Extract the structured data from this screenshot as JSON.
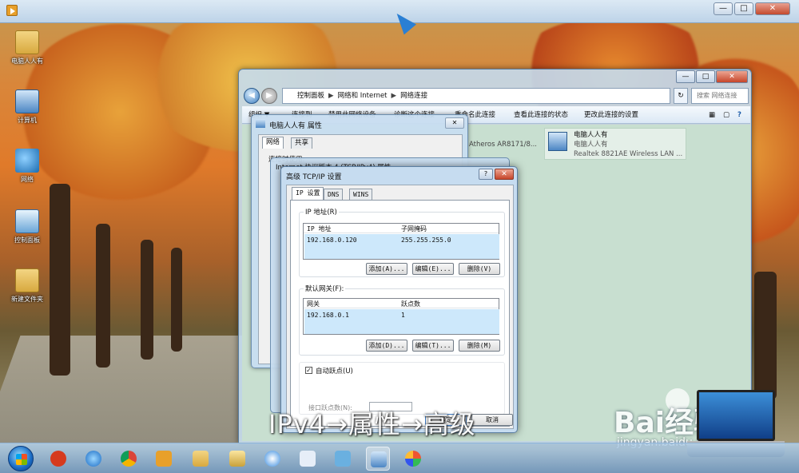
{
  "video": {
    "controls": {
      "minimize": "—",
      "maximize": "□",
      "close": "✕"
    }
  },
  "desktop": {
    "icons": [
      {
        "label": "电脑人人有",
        "icon": "folder-icon"
      },
      {
        "label": "计算机",
        "icon": "computer-icon"
      },
      {
        "label": "网络",
        "icon": "network-icon"
      },
      {
        "label": "控制面板",
        "icon": "control-panel-icon"
      },
      {
        "label": "新建文件夹",
        "icon": "folder-icon"
      }
    ]
  },
  "explorer": {
    "back": "◀",
    "forward": "▶",
    "breadcrumb": [
      "控制面板",
      "网络和 Internet",
      "网络连接"
    ],
    "search_placeholder": "搜索 网络连接",
    "commands": [
      "组织 ▼",
      "连接到",
      "禁用此网络设备",
      "诊断这个连接",
      "重命名此连接",
      "查看此连接的状态",
      "更改此连接的设置"
    ],
    "atheros_label": "Atheros AR8171/8...",
    "connection": {
      "name": "电脑人人有",
      "status": "电脑人人有",
      "adapter": "Realtek 8821AE Wireless LAN ..."
    }
  },
  "properties": {
    "title": "电脑人人有 属性",
    "tabs": [
      "网络",
      "共享"
    ],
    "connect_using": "连接时使用:"
  },
  "ipv4": {
    "title": "Internet 协议版本 4 (TCP/IPv4) 属性"
  },
  "advanced": {
    "title": "高级 TCP/IP 设置",
    "help": "?",
    "tabs": [
      "IP 设置",
      "DNS",
      "WINS"
    ],
    "ip_group": {
      "label": "IP 地址(R)",
      "headers": [
        "IP 地址",
        "子网掩码"
      ],
      "rows": [
        {
          "ip": "192.168.0.120",
          "mask": "255.255.255.0"
        }
      ],
      "buttons": [
        "添加(A)...",
        "编辑(E)...",
        "删除(V)"
      ]
    },
    "gateway_group": {
      "label": "默认网关(F):",
      "headers": [
        "网关",
        "跃点数"
      ],
      "rows": [
        {
          "gateway": "192.168.0.1",
          "metric": "1"
        }
      ],
      "buttons": [
        "添加(D)...",
        "编辑(T)...",
        "删除(M)"
      ]
    },
    "auto_metric": {
      "label": "自动跃点(U)",
      "checked": "✓"
    },
    "interface_metric_label": "接口跃点数(N):",
    "ok": "确定",
    "cancel": "取消"
  },
  "caption": "IPv4→属性→高级",
  "watermark": {
    "brand": "Bai经验",
    "url": "jingyan.baidu.com"
  },
  "colors": {
    "accent": "#1a6bc4",
    "selection": "#cde8fb"
  }
}
